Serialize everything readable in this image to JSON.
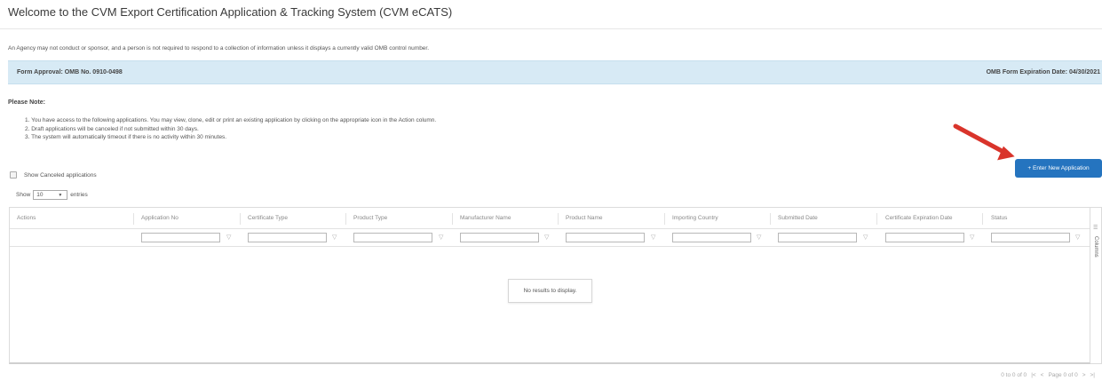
{
  "page": {
    "title": "Welcome to the CVM Export Certification Application & Tracking System (CVM eCATS)",
    "omb_notice": "An Agency may not conduct or sponsor, and a person is not required to respond to a collection of information unless it displays a currently valid OMB control number."
  },
  "omb_bar": {
    "approval": "Form Approval: OMB No. 0910-0498",
    "expiration": "OMB Form Expiration Date: 04/30/2021"
  },
  "notes": {
    "heading": "Please Note:",
    "items": [
      "1. You have access to the following applications. You may view, clone, edit or print an existing application by clicking on the appropriate icon in the Action column.",
      "2. Draft applications will be canceled if not submitted within 30 days.",
      "3. The system will automatically timeout if there is no activity within 30 minutes."
    ]
  },
  "enter_button": {
    "label": "+ Enter New Application"
  },
  "show_canceled": {
    "label": "Show Canceled applications"
  },
  "entries": {
    "prefix": "Show",
    "value": "10",
    "suffix": "entries"
  },
  "grid": {
    "columns": [
      "Actions",
      "Application No",
      "Certificate Type",
      "Product Type",
      "Manufacturer Name",
      "Product Name",
      "Importing Country",
      "Submitted Date",
      "Certificate Expiration Date",
      "Status"
    ],
    "empty_message": "No results to display.",
    "columns_panel_label": "Columns"
  },
  "pager": {
    "range": "0 to 0 of 0",
    "page": "Page 0 of 0"
  },
  "colors": {
    "accent": "#2574bf",
    "omb_bar": "#d7eaf5",
    "arrow": "#d9342b"
  }
}
